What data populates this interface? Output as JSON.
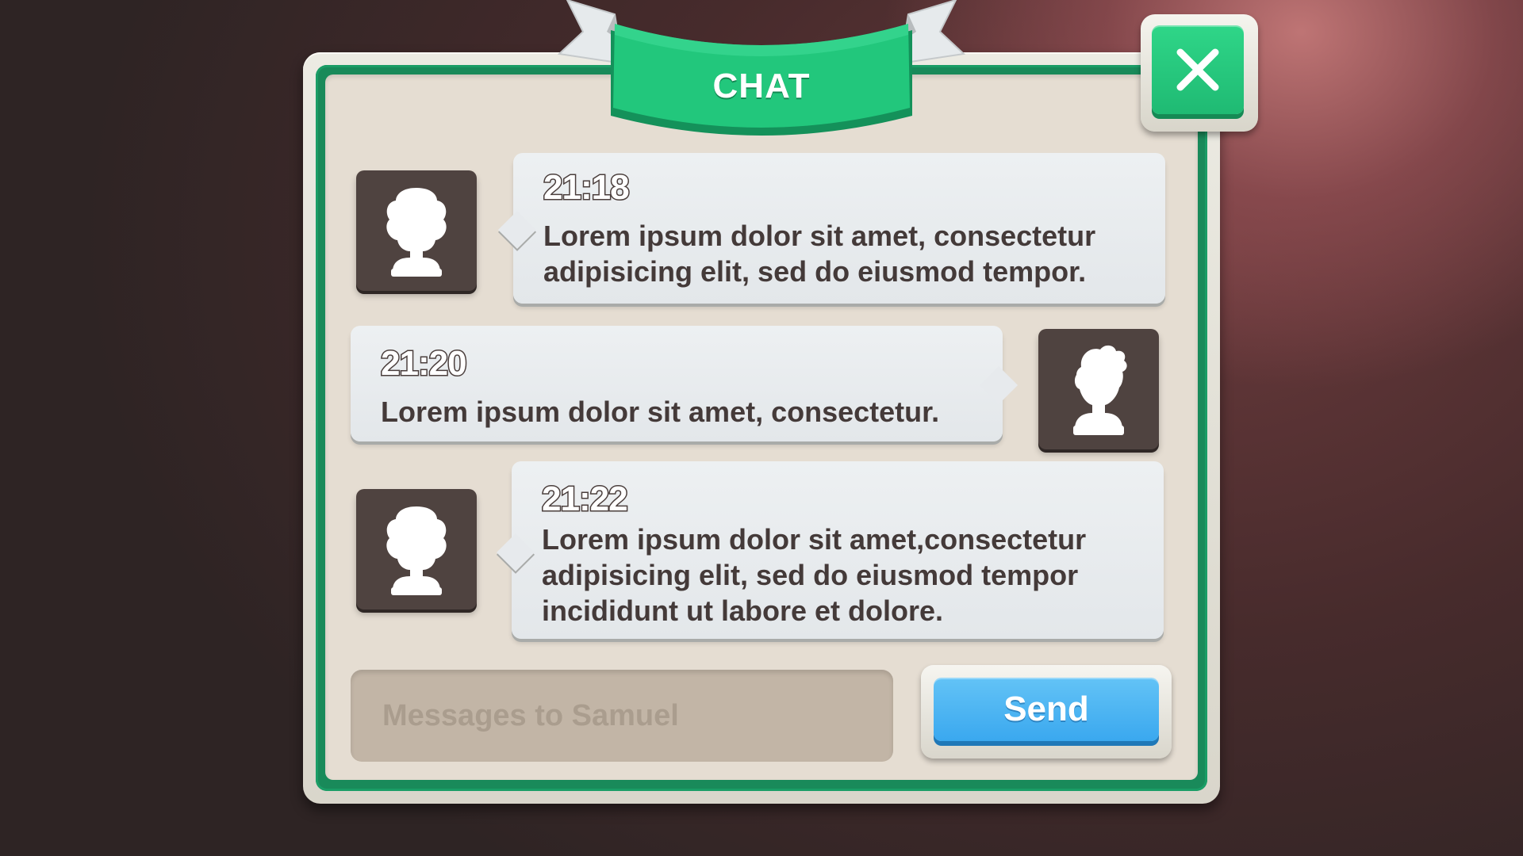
{
  "panel": {
    "title": "CHAT"
  },
  "close_button": {
    "icon": "close-icon"
  },
  "messages": [
    {
      "time": "21:18",
      "text": "Lorem ipsum dolor sit amet, consectetur\nadipisicing elit, sed do eiusmod tempor.",
      "side": "left",
      "avatar": "female-avatar-icon"
    },
    {
      "time": "21:20",
      "text": "Lorem ipsum dolor sit amet, consectetur.",
      "side": "right",
      "avatar": "male-avatar-icon"
    },
    {
      "time": "21:22",
      "text": "Lorem ipsum dolor sit amet,consectetur\nadipisicing elit, sed do eiusmod tempor\nincididunt ut labore et dolore.",
      "side": "left",
      "avatar": "female-avatar-icon"
    }
  ],
  "composer": {
    "input_value": "",
    "placeholder": "Messages to Samuel",
    "send_label": "Send"
  },
  "colors": {
    "accent_green": "#22c77c",
    "frame_green": "#198a5a",
    "send_blue": "#4bb6f3",
    "avatar_bg": "#4f4340",
    "text_dark": "#443a39",
    "panel_bg": "#e5ddd2"
  }
}
